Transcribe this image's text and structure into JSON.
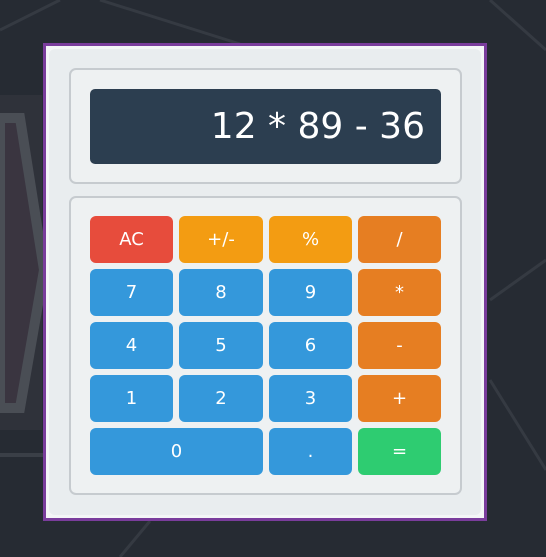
{
  "display": {
    "expression": "12 * 89 - 36"
  },
  "keys": {
    "ac": "AC",
    "sign": "+/-",
    "percent": "%",
    "divide": "/",
    "seven": "7",
    "eight": "8",
    "nine": "9",
    "multiply": "*",
    "four": "4",
    "five": "5",
    "six": "6",
    "subtract": "-",
    "one": "1",
    "two": "2",
    "three": "3",
    "add": "+",
    "zero": "0",
    "decimal": ".",
    "equals": "="
  },
  "colors": {
    "ac": "#e74c3c",
    "function": "#f39c12",
    "operator": "#e67e22",
    "number": "#3498db",
    "equals": "#2ecc71",
    "display_bg": "#2c3e50"
  }
}
